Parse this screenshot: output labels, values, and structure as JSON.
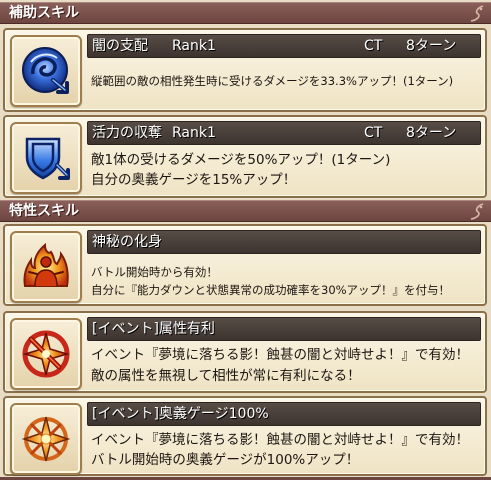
{
  "sections": {
    "support": {
      "title": "補助スキル"
    },
    "trait": {
      "title": "特性スキル"
    }
  },
  "skills": [
    {
      "name": "闇の支配",
      "rank": "Rank1",
      "ct_label": "CT",
      "ct_value": "8ターン",
      "icon": "dark-swirl-arrow-icon",
      "lines": [
        "縦範囲の敵の相性発生時に受けるダメージを33.3%アップ！(1ターン)"
      ]
    },
    {
      "name": "活力の収奪",
      "rank": "Rank1",
      "ct_label": "CT",
      "ct_value": "8ターン",
      "icon": "shield-arrow-icon",
      "lines": [
        "敵1体の受けるダメージを50%アップ！(1ターン)",
        "自分の奥義ゲージを15%アップ！"
      ]
    }
  ],
  "traits": [
    {
      "name": "神秘の化身",
      "icon": "flaming-figure-icon",
      "lines": [
        "バトル開始時から有効！",
        "自分に『能力ダウンと状態異常の成功確率を30%アップ！』を付与！"
      ]
    },
    {
      "name": "[イベント]属性有利",
      "icon": "red-star-burst-icon",
      "lines": [
        "イベント『夢境に落ちる影！蝕甚の闇と対峙せよ！』で有効！",
        "敵の属性を無視して相性が常に有利になる！"
      ]
    },
    {
      "name": "[イベント]奥義ゲージ100%",
      "icon": "orange-star-burst-icon",
      "lines": [
        "イベント『夢境に落ちる影！蝕甚の闇と対峙せよ！』で有効！",
        "バトル開始時の奥義ゲージが100%アップ！"
      ]
    }
  ],
  "colors": {
    "header": "#6d4540",
    "card_border": "#8b6f49",
    "title_bar": "#3d342f",
    "dark_icon_blue": "#2b5fd0",
    "shield_blue": "#2a6ed6",
    "flame_orange": "#f08a1c",
    "burst_red": "#c8281a"
  }
}
